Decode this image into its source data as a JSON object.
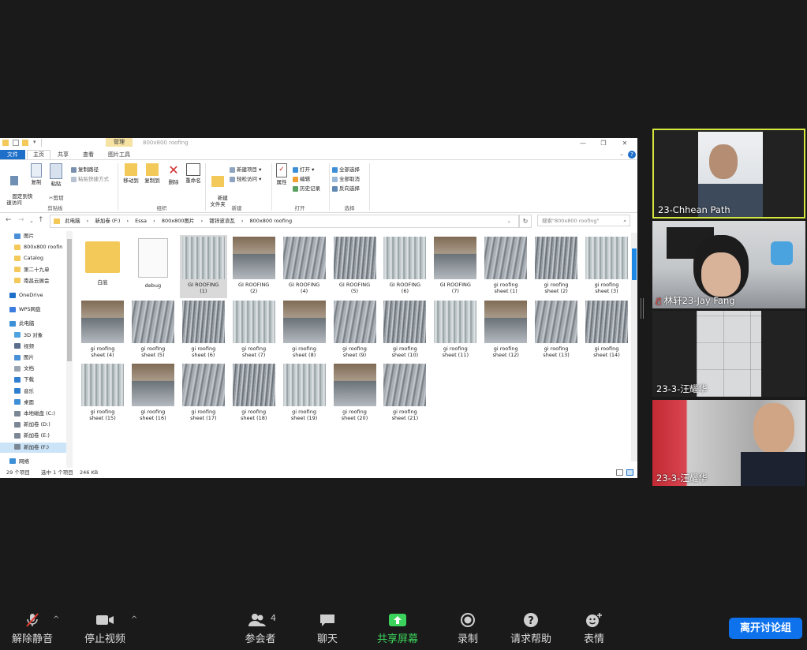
{
  "explorer": {
    "context_tab": "管理",
    "window_title": "800x800 roofing",
    "ribbon_tabs": [
      "文件",
      "主页",
      "共享",
      "查看",
      "图片工具"
    ],
    "groups": {
      "clipboard": {
        "pin": "固定到快\n速访问",
        "copy": "复制",
        "paste": "粘贴",
        "copy_path": "复制路径",
        "paste_shortcut": "粘贴快捷方式",
        "cut": "剪切",
        "label": "剪贴板"
      },
      "organize": {
        "move_to": "移动到",
        "copy_to": "复制到",
        "delete": "删除",
        "rename": "重命名",
        "label": "组织"
      },
      "new": {
        "new_folder": "新建\n文件夹",
        "new_item": "新建项目",
        "easy_access": "轻松访问",
        "label": "新建"
      },
      "open": {
        "properties": "属性",
        "open": "打开",
        "edit": "编辑",
        "history": "历史记录",
        "label": "打开"
      },
      "select": {
        "select_all": "全部选择",
        "select_none": "全部取消",
        "invert": "反向选择",
        "label": "选择"
      }
    },
    "breadcrumb": [
      "此电脑",
      "›",
      "新加卷 (F:)",
      "›",
      "Essa",
      "›",
      "800x800图片",
      "›",
      "镀锌波浪瓦",
      "›",
      "800x800 roofing"
    ],
    "search_placeholder": "搜索\"800x800 roofing\"",
    "nav_items": [
      {
        "label": "图片",
        "color": "#4a90d9"
      },
      {
        "label": "800x800 roofin",
        "color": "#f3c95a"
      },
      {
        "label": "Catalog",
        "color": "#f3c95a"
      },
      {
        "label": "第二十九单",
        "color": "#f3c95a"
      },
      {
        "label": "南昌云展会",
        "color": "#f3c95a"
      },
      {
        "label": "",
        "color": ""
      },
      {
        "label": "OneDrive",
        "color": "#1e6fc9"
      },
      {
        "label": "",
        "color": ""
      },
      {
        "label": "WPS网盘",
        "color": "#3d7de0"
      },
      {
        "label": "",
        "color": ""
      },
      {
        "label": "此电脑",
        "color": "#3d8fd6"
      },
      {
        "label": "3D 对象",
        "color": "#4fa3e0"
      },
      {
        "label": "视频",
        "color": "#5a6e8c"
      },
      {
        "label": "图片",
        "color": "#4a90d9"
      },
      {
        "label": "文档",
        "color": "#9aa5b1"
      },
      {
        "label": "下载",
        "color": "#2f7fd0"
      },
      {
        "label": "音乐",
        "color": "#2f7fd0"
      },
      {
        "label": "桌面",
        "color": "#3d8fd6"
      },
      {
        "label": "本地磁盘 (C:)",
        "color": "#7b8794"
      },
      {
        "label": "新加卷 (D:)",
        "color": "#7b8794"
      },
      {
        "label": "新加卷 (E:)",
        "color": "#7b8794"
      },
      {
        "label": "新加卷 (F:)",
        "color": "#7b8794"
      },
      {
        "label": "",
        "color": ""
      },
      {
        "label": "网络",
        "color": "#3d8fd6"
      }
    ],
    "files": [
      {
        "l1": "白底",
        "l2": "",
        "kind": "folder"
      },
      {
        "l1": "debug",
        "l2": "",
        "kind": "doc"
      },
      {
        "l1": "GI ROOFING",
        "l2": "(1)",
        "kind": "img",
        "selected": true
      },
      {
        "l1": "GI ROOFING",
        "l2": "(2)",
        "kind": "img"
      },
      {
        "l1": "GI ROOFING",
        "l2": "(4)",
        "kind": "img"
      },
      {
        "l1": "GI ROOFING",
        "l2": "(5)",
        "kind": "img"
      },
      {
        "l1": "GI ROOFING",
        "l2": "(6)",
        "kind": "img"
      },
      {
        "l1": "GI ROOFING",
        "l2": "(7)",
        "kind": "img"
      },
      {
        "l1": "gi roofing",
        "l2": "sheet (1)",
        "kind": "img"
      },
      {
        "l1": "gi roofing",
        "l2": "sheet (2)",
        "kind": "img"
      },
      {
        "l1": "gi roofing",
        "l2": "sheet (3)",
        "kind": "img"
      },
      {
        "l1": "gi roofing",
        "l2": "sheet (4)",
        "kind": "img"
      },
      {
        "l1": "gi roofing",
        "l2": "sheet (5)",
        "kind": "img"
      },
      {
        "l1": "gi roofing",
        "l2": "sheet (6)",
        "kind": "img"
      },
      {
        "l1": "gi roofing",
        "l2": "sheet (7)",
        "kind": "img"
      },
      {
        "l1": "gi roofing",
        "l2": "sheet (8)",
        "kind": "img"
      },
      {
        "l1": "gi roofing",
        "l2": "sheet (9)",
        "kind": "img"
      },
      {
        "l1": "gi roofing",
        "l2": "sheet (10)",
        "kind": "img"
      },
      {
        "l1": "gi roofing",
        "l2": "sheet (11)",
        "kind": "img"
      },
      {
        "l1": "gi roofing",
        "l2": "sheet (12)",
        "kind": "img"
      },
      {
        "l1": "gi roofing",
        "l2": "sheet (13)",
        "kind": "img"
      },
      {
        "l1": "gi roofing",
        "l2": "sheet (14)",
        "kind": "img"
      },
      {
        "l1": "gi roofing",
        "l2": "sheet (15)",
        "kind": "img"
      },
      {
        "l1": "gi roofing",
        "l2": "sheet (16)",
        "kind": "img"
      },
      {
        "l1": "gi roofing",
        "l2": "sheet (17)",
        "kind": "img"
      },
      {
        "l1": "gi roofing",
        "l2": "sheet (18)",
        "kind": "img"
      },
      {
        "l1": "gi roofing",
        "l2": "sheet (19)",
        "kind": "img"
      },
      {
        "l1": "gi roofing",
        "l2": "sheet (20)",
        "kind": "img"
      },
      {
        "l1": "gi roofing",
        "l2": "sheet (21)",
        "kind": "img"
      }
    ],
    "status": {
      "count": "29 个项目",
      "selected": "选中 1 个项目",
      "size": "246 KB"
    }
  },
  "participants": [
    {
      "name": "23-Chhean Path",
      "active": true
    },
    {
      "name": "林轩23-Jay Fang",
      "muted": true
    },
    {
      "name": "23-3-汪耀华"
    },
    {
      "name": "23-3-汪耀华"
    }
  ],
  "toolbar": {
    "unmute": "解除静音",
    "stop_video": "停止视频",
    "participants": "参会者",
    "participants_count": "4",
    "chat": "聊天",
    "share": "共享屏幕",
    "record": "录制",
    "help": "请求帮助",
    "reactions": "表情",
    "leave": "离开讨论组"
  },
  "colors": {
    "accent": "#0e72ed",
    "share_green": "#3bd35b",
    "active_speaker": "#d6e840",
    "ribbon_blue": "#1e6fc9"
  }
}
